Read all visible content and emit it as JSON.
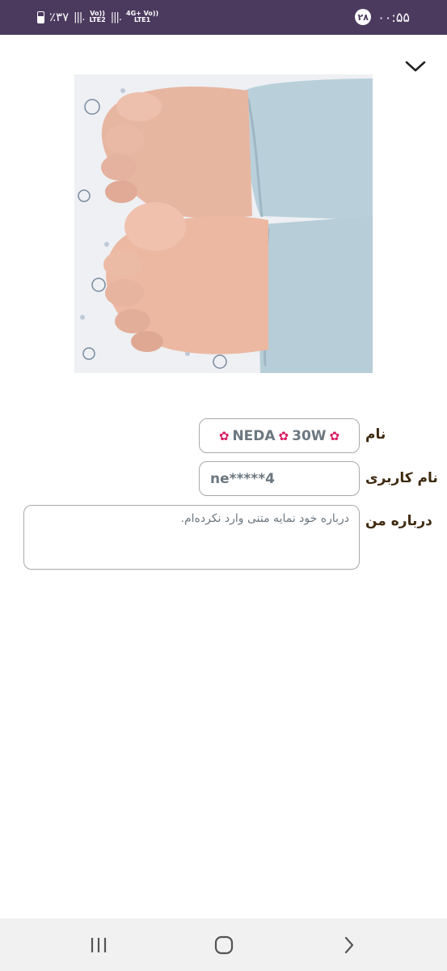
{
  "status_bar": {
    "battery": "٪۳۷",
    "sim2": {
      "top": "Vo))",
      "bottom": "LTE2"
    },
    "sim1": {
      "top": "4G+ Vo))",
      "bottom": "LTE1"
    },
    "notification_count": "۲۸",
    "time": "۰۰:۵۵"
  },
  "profile": {
    "fields": {
      "name_label": "نام",
      "name_parts": [
        "NEDA",
        "30W"
      ],
      "username_label": "نام کاربری",
      "username_value": "ne*****4",
      "about_label": "درباره من",
      "about_value": "درباره خود نمایه متنی وارد نکرده‌ام."
    }
  },
  "icons": {
    "collapse": "chevron-down-icon",
    "flower": "hibiscus-icon",
    "nav_recent": "recent-apps-icon",
    "nav_home": "home-icon",
    "nav_back": "back-icon"
  },
  "colors": {
    "status_bar": "#4b3a5e",
    "label_text": "#3f2a10",
    "field_text": "#6c7780",
    "field_border": "#a9a9a9",
    "nav_bar": "#f1f1f1"
  }
}
